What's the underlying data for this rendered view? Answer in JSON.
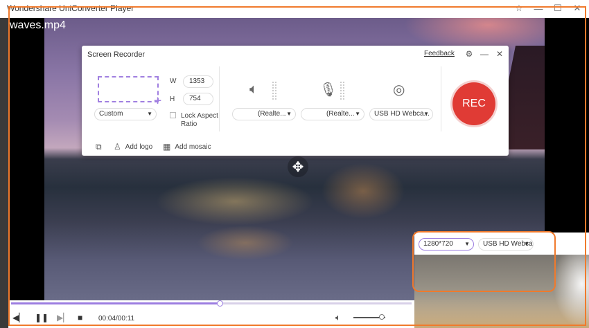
{
  "window": {
    "title": "Wondershare UniConverter Player"
  },
  "video": {
    "filename": "waves.mp4"
  },
  "recorder": {
    "title": "Screen Recorder",
    "feedback_label": "Feedback",
    "width_label": "W",
    "width_value": "1353",
    "height_label": "H",
    "height_value": "754",
    "size_preset": "Custom",
    "lock_aspect_label": "Lock Aspect Ratio",
    "speaker_device": "(Realte...",
    "mic_device": "(Realte...",
    "camera_device": "USB HD Webca...",
    "rec_label": "REC",
    "add_logo_label": "Add logo",
    "add_mosaic_label": "Add mosaic"
  },
  "player": {
    "time": "00:04/00:11",
    "progress": 0.52,
    "volume": 0.9
  },
  "webcam": {
    "resolution": "1280*720",
    "device": "USB HD Webca"
  },
  "colors": {
    "accent": "#9b7de0",
    "rec": "#e03b35",
    "highlight": "#f07a2c"
  }
}
